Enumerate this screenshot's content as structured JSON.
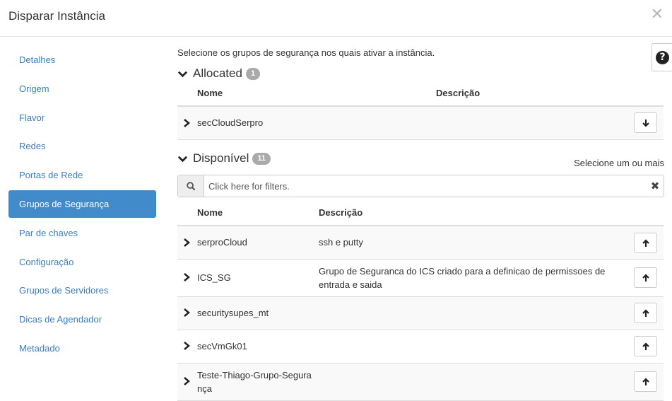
{
  "dialog": {
    "title": "Disparar Instância",
    "close_glyph": "✕"
  },
  "sidebar": {
    "items": [
      {
        "label": "Detalhes",
        "active": false
      },
      {
        "label": "Origem",
        "active": false
      },
      {
        "label": "Flavor",
        "active": false
      },
      {
        "label": "Redes",
        "active": false
      },
      {
        "label": "Portas de Rede",
        "active": false
      },
      {
        "label": "Grupos de Segurança",
        "active": true
      },
      {
        "label": "Par de chaves",
        "active": false
      },
      {
        "label": "Configuração",
        "active": false
      },
      {
        "label": "Grupos de Servidores",
        "active": false
      },
      {
        "label": "Dicas de Agendador",
        "active": false
      },
      {
        "label": "Metadado",
        "active": false
      }
    ]
  },
  "main": {
    "help_text": "Selecione os grupos de segurança nos quais ativar a instância.",
    "help_icon": "question-circle-icon",
    "allocated": {
      "title": "Allocated",
      "count": "1",
      "columns": {
        "name": "Nome",
        "description": "Descrição"
      },
      "rows": [
        {
          "name": "secCloudSerpro",
          "description": ""
        }
      ]
    },
    "available": {
      "title": "Disponível",
      "count": "11",
      "select_hint": "Selecione um ou mais",
      "search": {
        "placeholder": "Click here for filters.",
        "value": ""
      },
      "columns": {
        "name": "Nome",
        "description": "Descrição"
      },
      "rows": [
        {
          "name": "serproCloud",
          "description": "ssh e putty"
        },
        {
          "name": "ICS_SG",
          "description": "Grupo de Seguranca do ICS criado para a definicao de permissoes de entrada e saida"
        },
        {
          "name": "securitysupes_mt",
          "description": ""
        },
        {
          "name": "secVmGk01",
          "description": ""
        },
        {
          "name": "Teste-Thiago-Grupo-Segurança",
          "description": ""
        }
      ]
    }
  },
  "colors": {
    "accent": "#428bca",
    "link": "#3d7dbf",
    "badge": "#aaaaaa",
    "row_shade": "#f9f9f9"
  }
}
